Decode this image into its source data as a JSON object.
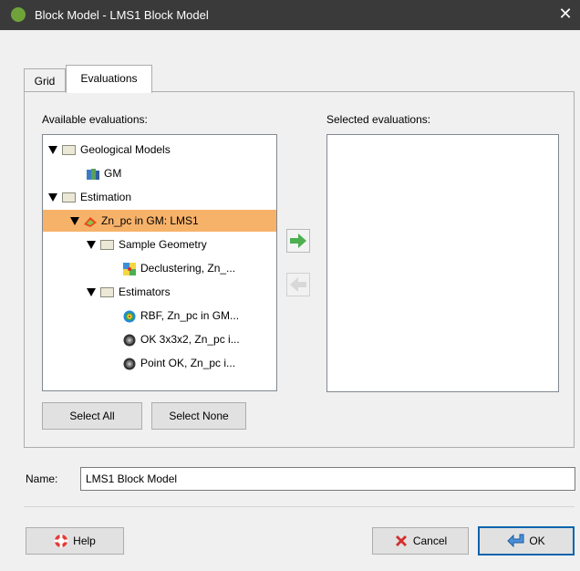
{
  "window": {
    "title": "Block Model - LMS1 Block Model",
    "close_glyph": "✕"
  },
  "tabs": [
    {
      "label": "Grid"
    },
    {
      "label": "Evaluations"
    }
  ],
  "available": {
    "label": "Available evaluations:",
    "tree": [
      {
        "label": "Geological Models"
      },
      {
        "label": "GM"
      },
      {
        "label": "Estimation"
      },
      {
        "label": "Zn_pc in GM: LMS1"
      },
      {
        "label": "Sample Geometry"
      },
      {
        "label": "Declustering, Zn_..."
      },
      {
        "label": "Estimators"
      },
      {
        "label": "RBF, Zn_pc in GM..."
      },
      {
        "label": "OK 3x3x2, Zn_pc i..."
      },
      {
        "label": "Point OK, Zn_pc i..."
      }
    ]
  },
  "selected": {
    "label": "Selected evaluations:"
  },
  "buttons": {
    "select_all": "Select All",
    "select_none": "Select None",
    "help": "Help",
    "cancel": "Cancel",
    "ok": "OK"
  },
  "name": {
    "label": "Name:",
    "value": "LMS1 Block Model"
  },
  "colors": {
    "selected_row": "#f7b26a",
    "arrow_green": "#4caf50"
  }
}
